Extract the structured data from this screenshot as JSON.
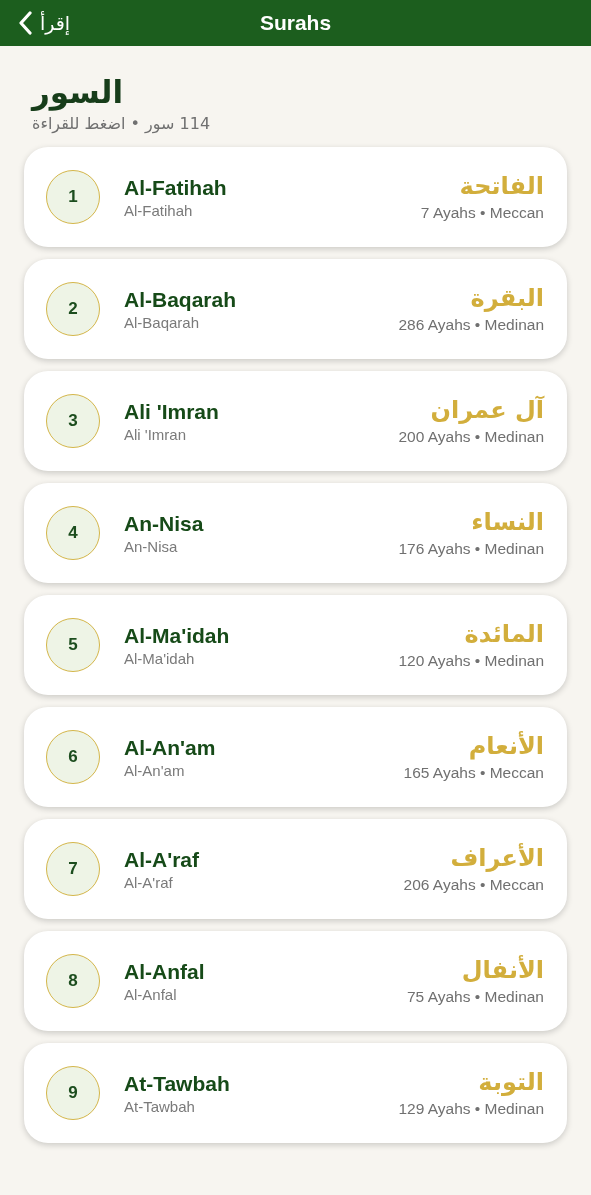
{
  "nav_bar": {
    "back_label": "إقرأ",
    "title": "Surahs"
  },
  "header": {
    "title": "السور",
    "subtitle": "114 سور • اضغط للقراءة"
  },
  "surahs": [
    {
      "number": "1",
      "name": "Al-Fatihah",
      "transliteration": "Al-Fatihah",
      "arabic": "الفاتحة",
      "info": "7 Ayahs • Meccan"
    },
    {
      "number": "2",
      "name": "Al-Baqarah",
      "transliteration": "Al-Baqarah",
      "arabic": "البقرة",
      "info": "286 Ayahs • Medinan"
    },
    {
      "number": "3",
      "name": "Ali 'Imran",
      "transliteration": "Ali 'Imran",
      "arabic": "آل عمران",
      "info": "200 Ayahs • Medinan"
    },
    {
      "number": "4",
      "name": "An-Nisa",
      "transliteration": "An-Nisa",
      "arabic": "النساء",
      "info": "176 Ayahs • Medinan"
    },
    {
      "number": "5",
      "name": "Al-Ma'idah",
      "transliteration": "Al-Ma'idah",
      "arabic": "المائدة",
      "info": "120 Ayahs • Medinan"
    },
    {
      "number": "6",
      "name": "Al-An'am",
      "transliteration": "Al-An'am",
      "arabic": "الأنعام",
      "info": "165 Ayahs • Meccan"
    },
    {
      "number": "7",
      "name": "Al-A'raf",
      "transliteration": "Al-A'raf",
      "arabic": "الأعراف",
      "info": "206 Ayahs • Meccan"
    },
    {
      "number": "8",
      "name": "Al-Anfal",
      "transliteration": "Al-Anfal",
      "arabic": "الأنفال",
      "info": "75 Ayahs • Medinan"
    },
    {
      "number": "9",
      "name": "At-Tawbah",
      "transliteration": "At-Tawbah",
      "arabic": "التوبة",
      "info": "129 Ayahs • Medinan"
    }
  ]
}
